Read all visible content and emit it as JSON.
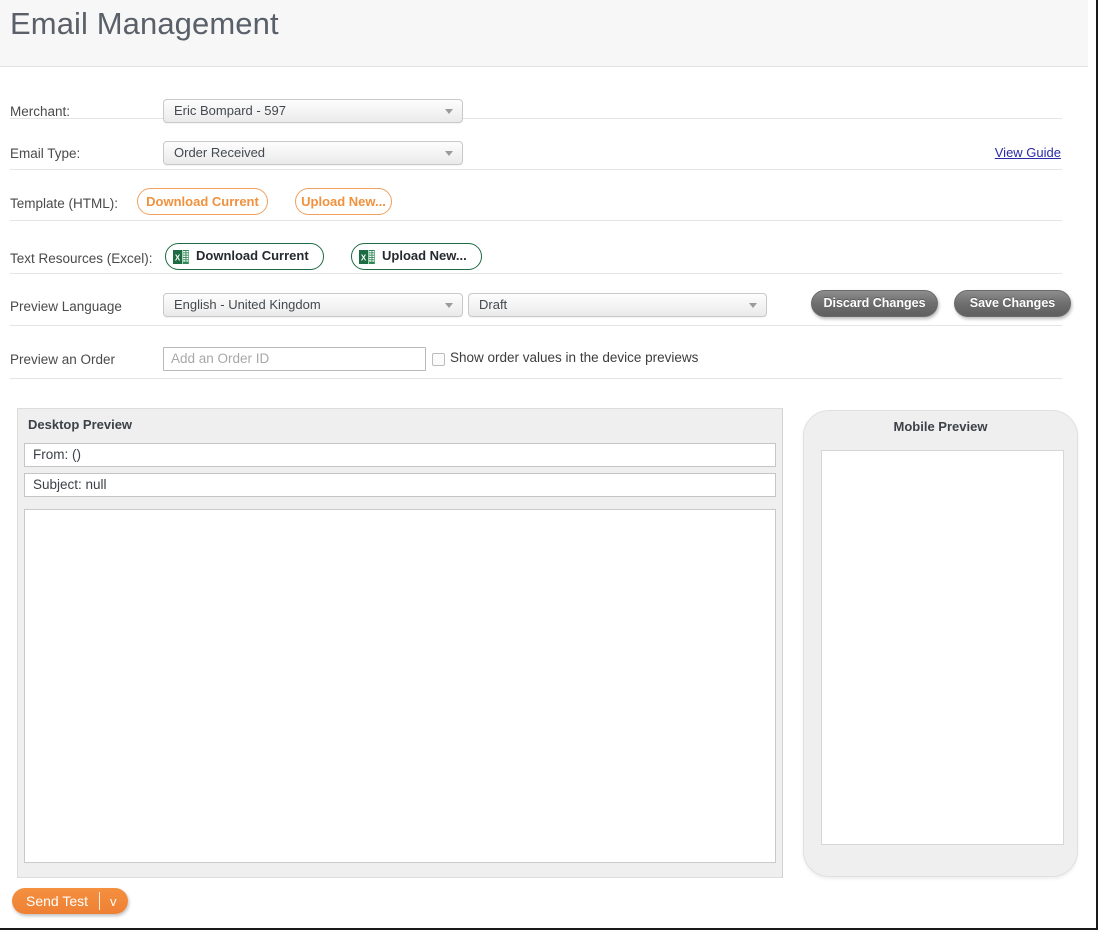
{
  "header": {
    "title": "Email Management"
  },
  "form": {
    "merchant": {
      "label": "Merchant:",
      "value": "Eric Bompard - 597"
    },
    "email_type": {
      "label": "Email Type:",
      "value": "Order Received",
      "guide_link": "View Guide"
    },
    "template_html": {
      "label": "Template (HTML):",
      "download_label": "Download Current",
      "upload_label": "Upload New..."
    },
    "text_resources": {
      "label": "Text Resources (Excel):",
      "download_label": "Download Current",
      "upload_label": "Upload New...",
      "icon": "excel-icon"
    },
    "preview_language": {
      "label": "Preview Language",
      "value": "English - United Kingdom",
      "status_value": "Draft",
      "discard_label": "Discard Changes",
      "save_label": "Save Changes"
    },
    "preview_order": {
      "label": "Preview an Order",
      "placeholder": "Add an Order ID",
      "value": "",
      "checkbox_label": "Show order values in the device previews",
      "checkbox_checked": false
    }
  },
  "desktop_preview": {
    "title": "Desktop Preview",
    "from": "From: ()",
    "subject": "Subject: null",
    "body": ""
  },
  "mobile_preview": {
    "title": "Mobile Preview",
    "body": ""
  },
  "footer": {
    "send_test_label": "Send Test",
    "send_test_caret": "v"
  },
  "colors": {
    "accent_orange": "#f0913e",
    "excel_green": "#1d6b42",
    "link_blue": "#2b2ba8",
    "header_bg": "#f7f7f7",
    "panel_bg": "#efefef"
  }
}
